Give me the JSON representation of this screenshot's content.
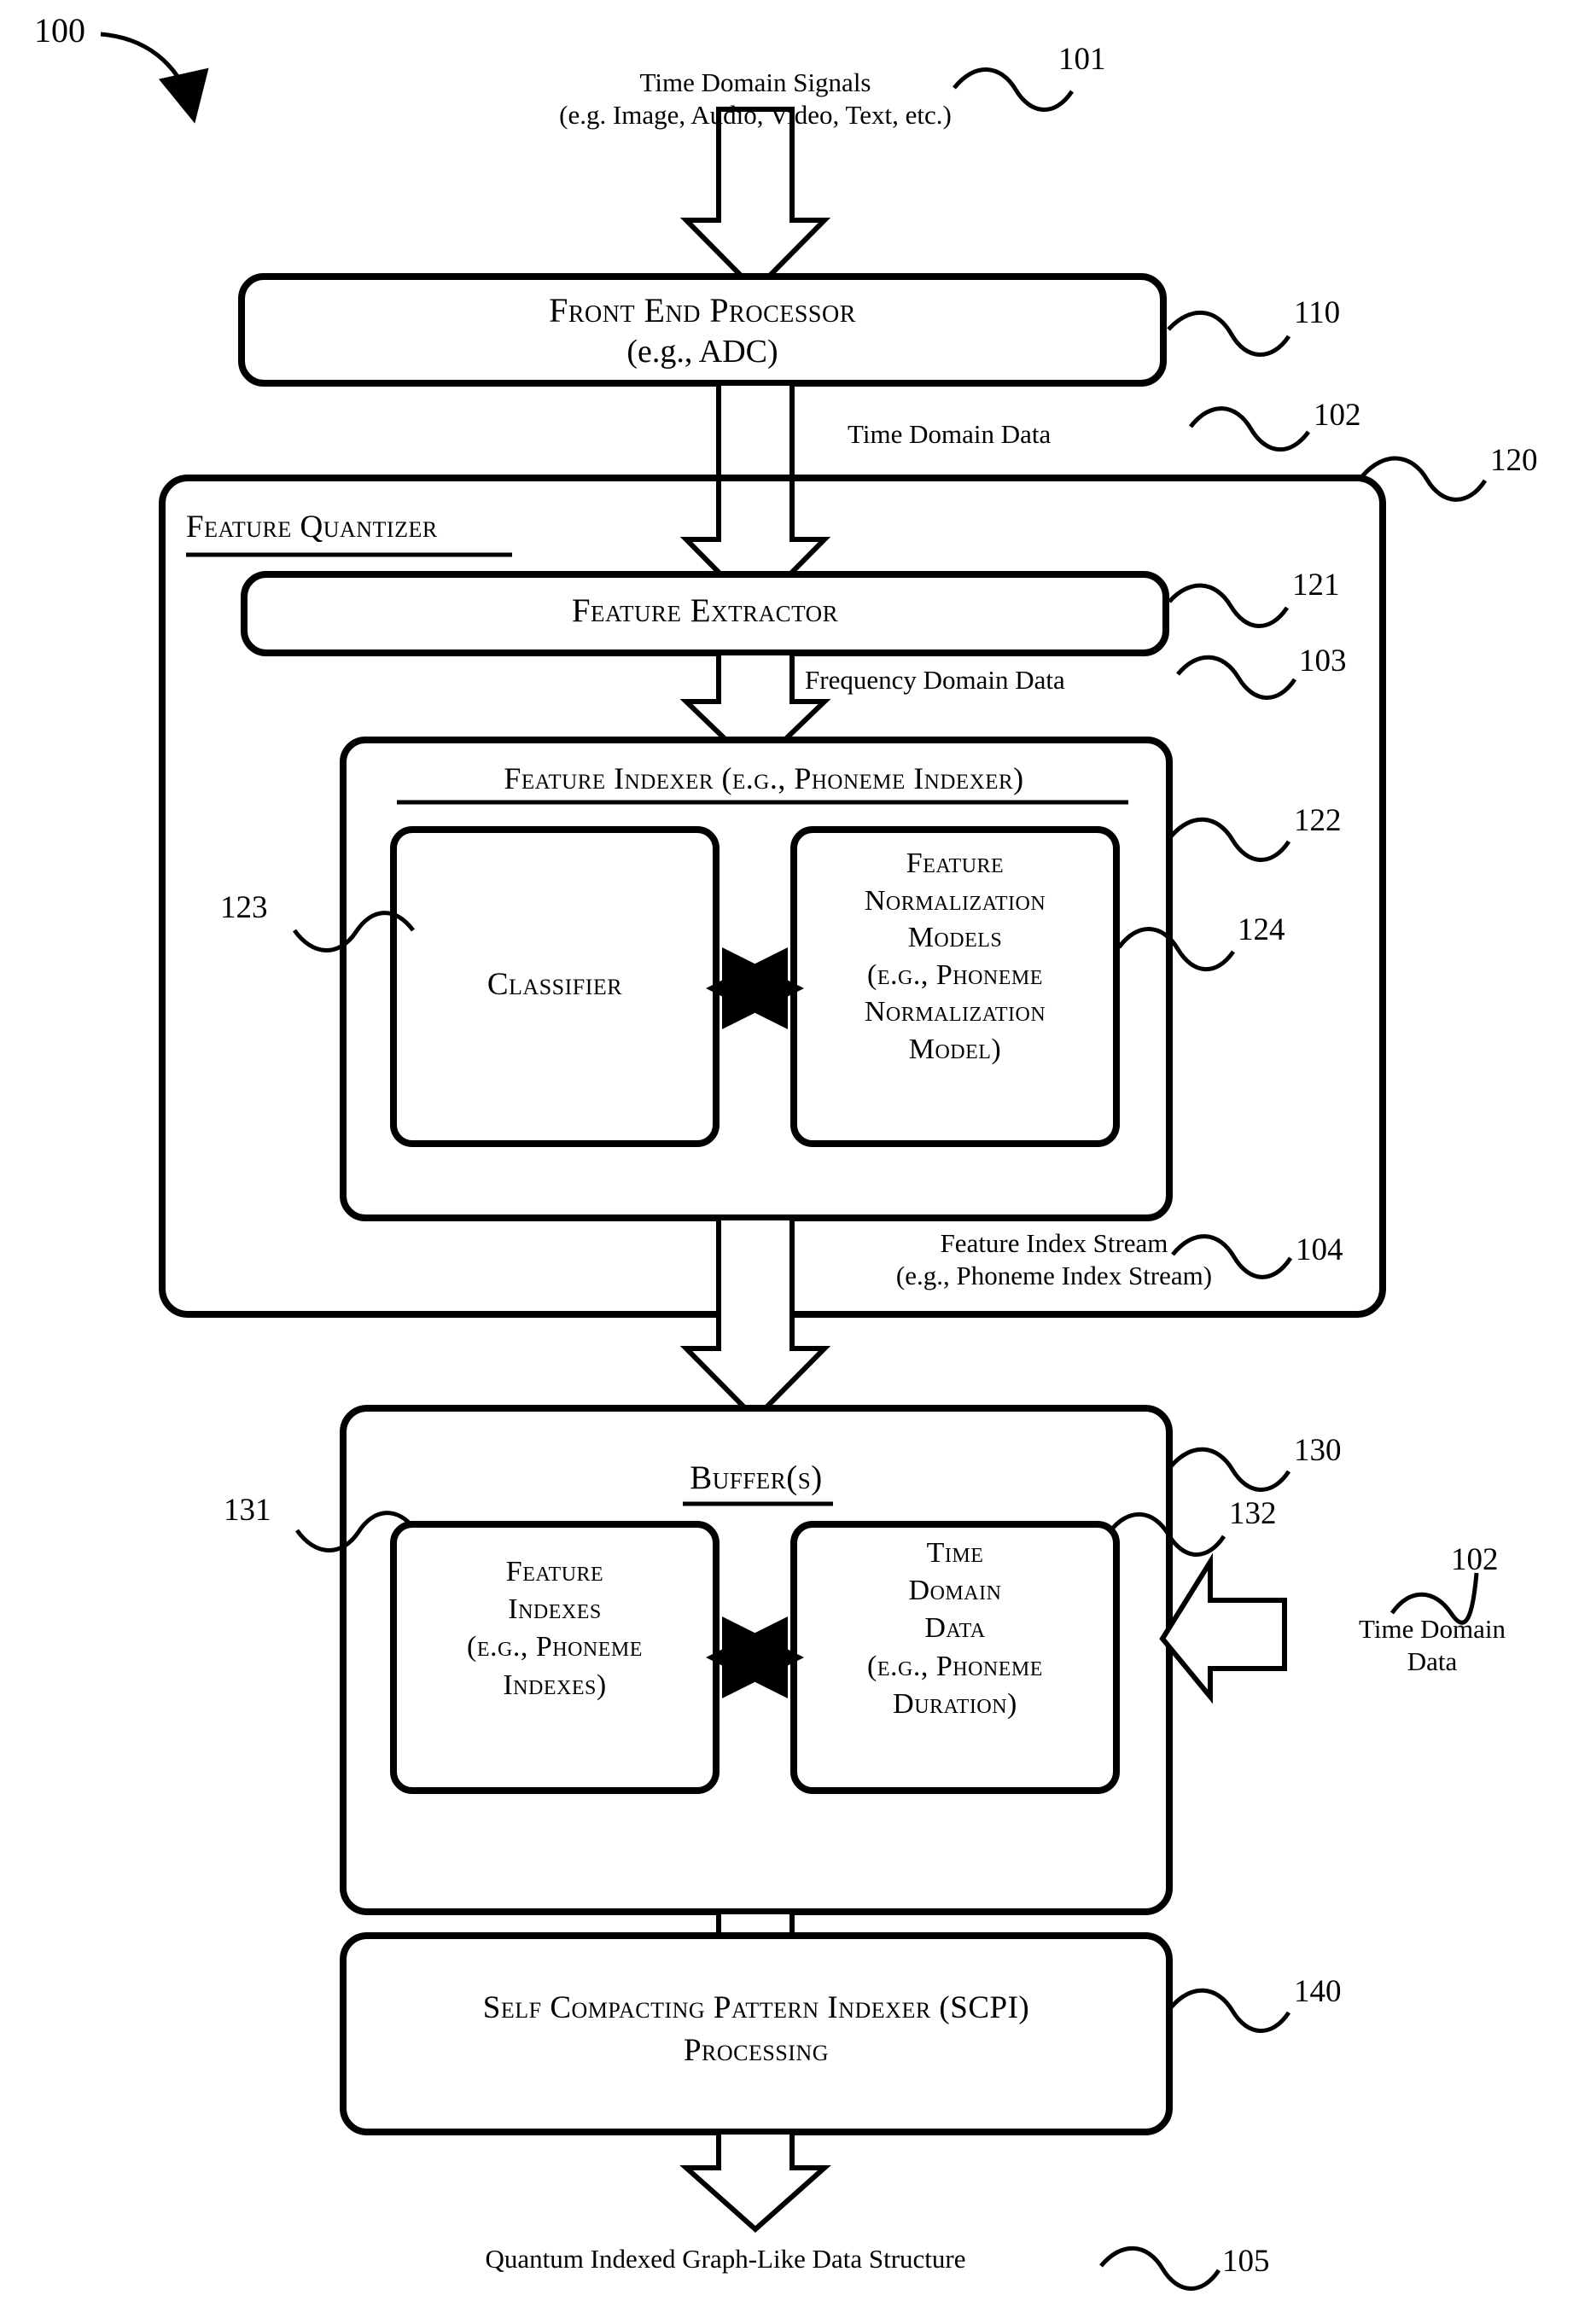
{
  "figure": {
    "number": "100",
    "title_caption": "100"
  },
  "signals": {
    "input_label": "Time Domain Signals\n(e.g. Image, Audio, Video, Text, etc.)",
    "input_ref": "101",
    "time_domain_data_label": "Time Domain Data",
    "time_domain_data_ref": "102",
    "frequency_domain_data_label": "Frequency Domain Data",
    "frequency_domain_data_ref": "103",
    "feature_index_stream_label": "Feature Index Stream\n(e.g., Phoneme Index Stream)",
    "feature_index_stream_ref": "104",
    "output_label": "Quantum Indexed Graph-Like Data Structure",
    "output_ref": "105",
    "side_input_label": "Time Domain\nData",
    "side_input_ref": "102"
  },
  "blocks": {
    "front_end_processor": {
      "title": "Front End Processor",
      "subtitle": "(e.g., ADC)",
      "ref": "110"
    },
    "feature_quantizer": {
      "title": "Feature Quantizer",
      "ref": "120"
    },
    "feature_extractor": {
      "title": "Feature Extractor",
      "ref": "121"
    },
    "feature_indexer": {
      "title": "Feature Indexer (e.g., Phoneme Indexer)",
      "ref": "122"
    },
    "classifier": {
      "title": "Classifier",
      "ref": "123"
    },
    "feature_normalization_models": {
      "title": "Feature\nNormalization\nModels\n(e.g., Phoneme\nNormalization\nModel)",
      "ref": "124"
    },
    "buffers": {
      "title": "Buffer(s)",
      "ref": "130"
    },
    "feature_indexes": {
      "title": "Feature\nIndexes\n(e.g., Phoneme\nIndexes)",
      "ref": "131"
    },
    "time_domain_data_buffer": {
      "title": "Time\nDomain\nData\n(e.g., Phoneme\nDuration)",
      "ref": "132"
    },
    "scpi": {
      "title": "Self Compacting Pattern Indexer (SCPI)\nProcessing",
      "ref": "140"
    }
  },
  "colors": {
    "stroke": "#000000",
    "fill": "#ffffff"
  }
}
